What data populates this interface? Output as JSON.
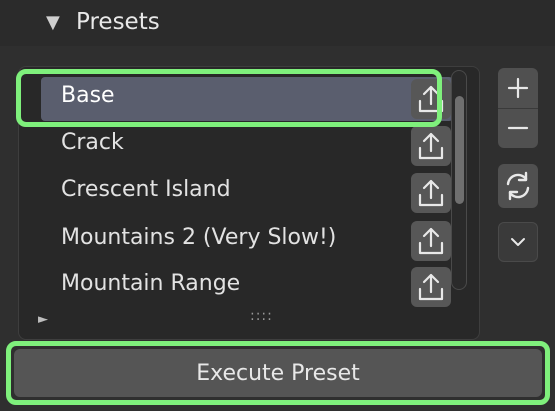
{
  "panel": {
    "title": "Presets",
    "caret": "▼"
  },
  "presets": {
    "items": [
      {
        "label": "Base",
        "selected": true
      },
      {
        "label": "Crack",
        "selected": false
      },
      {
        "label": "Crescent Island",
        "selected": false
      },
      {
        "label": "Mountains 2 (Very Slow!)",
        "selected": false
      },
      {
        "label": "Mountain Range",
        "selected": false
      }
    ],
    "row_icon": "export-upload-icon",
    "expand_arrow": "►",
    "resize_grip": "::::"
  },
  "side_buttons": {
    "add": "plus-icon",
    "remove": "minus-icon",
    "refresh": "refresh-icon",
    "more": "chevron-down-icon"
  },
  "execute_button": {
    "label": "Execute Preset"
  },
  "colors": {
    "highlight": "#7ff07c",
    "selected_row": "#5a5e6e",
    "background": "#2f2f2f"
  }
}
